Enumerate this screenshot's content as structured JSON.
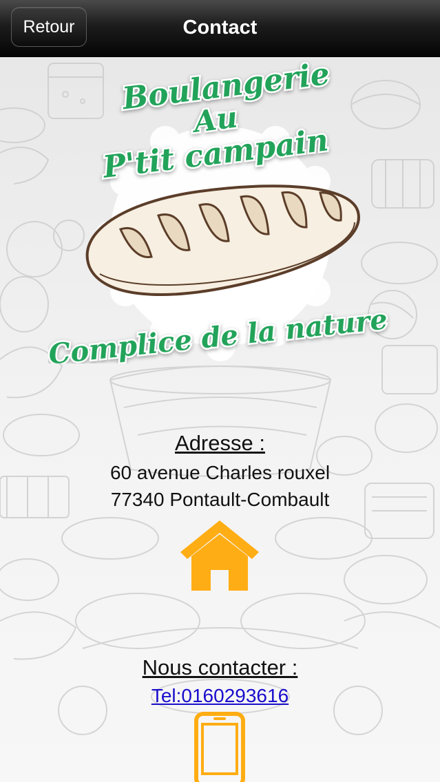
{
  "navbar": {
    "back_label": "Retour",
    "title": "Contact"
  },
  "logo": {
    "line1": "Boulangerie",
    "line2": "Au",
    "line3": "P'tit campain",
    "tagline": "Complice de la nature",
    "text_color": "#22a35a"
  },
  "address": {
    "title": "Adresse :",
    "line1": "60 avenue Charles rouxel",
    "line2": "77340 Pontault-Combault",
    "icon": "home-icon"
  },
  "contact": {
    "title": "Nous contacter :",
    "tel": "Tel:0160293616",
    "icon": "phone-icon"
  },
  "colors": {
    "icon_orange": "#ffad14",
    "link_blue": "#1a0dcc",
    "brand_green": "#22a35a"
  }
}
